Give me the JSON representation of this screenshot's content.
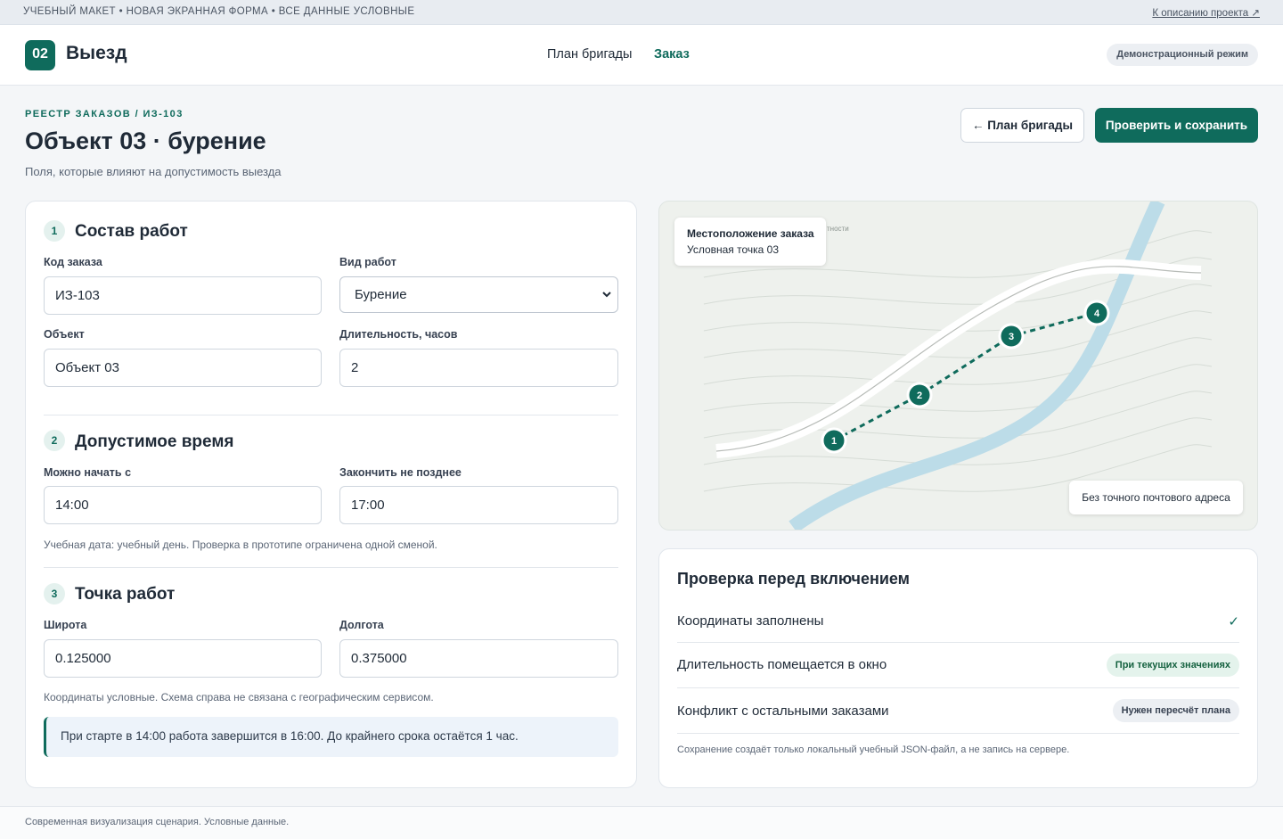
{
  "topbar": {
    "left_text": "УЧЕБНЫЙ МАКЕТ • НОВАЯ ЭКРАННАЯ ФОРМА • ВСЕ ДАННЫЕ УСЛОВНЫЕ",
    "right_link": "К описанию проекта ↗"
  },
  "header": {
    "logo": "02",
    "title": "Выезд",
    "nav": [
      "План бригады",
      "Заказ"
    ],
    "active_nav": "Заказ",
    "badge": "Демонстрационный режим"
  },
  "page": {
    "breadcrumb": "РЕЕСТР ЗАКАЗОВ / ИЗ-103",
    "title": "Объект 03 · бурение",
    "subtitle": "Поля, которые влияют на допустимость выезда",
    "back_button": "← План бригады",
    "save_button": "Проверить и сохранить"
  },
  "form": {
    "section1": {
      "num": "1",
      "title": "Состав работ",
      "order_code_label": "Код заказа",
      "order_code_value": "ИЗ-103",
      "work_type_label": "Вид работ",
      "work_type_value": "Бурение",
      "object_label": "Объект",
      "object_value": "Объект 03",
      "duration_label": "Длительность, часов",
      "duration_value": "2"
    },
    "section2": {
      "num": "2",
      "title": "Допустимое время",
      "start_label": "Можно начать с",
      "start_value": "14:00",
      "end_label": "Закончить не позднее",
      "end_value": "17:00",
      "hint": "Учебная дата: учебный день. Проверка в прототипе ограничена одной сменой."
    },
    "section3": {
      "num": "3",
      "title": "Точка работ",
      "lat_label": "Широта",
      "lat_value": "0.125000",
      "lon_label": "Долгота",
      "lon_value": "0.375000",
      "hint": "Координаты условные. Схема справа не связана с географическим сервисом.",
      "info": "При старте в 14:00 работа завершится в 16:00. До крайнего срока остаётся 1 час."
    }
  },
  "map": {
    "tooltip_title": "Местоположение заказа",
    "tooltip_sub": "Условная точка 03",
    "faint_label": "тности",
    "note": "Без точного почтового адреса",
    "markers": [
      "1",
      "2",
      "3",
      "4"
    ]
  },
  "check": {
    "title": "Проверка перед включением",
    "rows": [
      {
        "label": "Координаты заполнены",
        "status": "✓"
      },
      {
        "label": "Длительность помещается в окно",
        "status": "При текущих значениях"
      },
      {
        "label": "Конфликт с остальными заказами",
        "status": "Нужен пересчёт плана"
      }
    ],
    "footnote": "Сохранение создаёт только локальный учебный JSON-файл, а не запись на сервере."
  },
  "footer": {
    "text": "Современная визуализация сценария. Условные данные."
  },
  "colors": {
    "accent": "#0f6b5c",
    "water": "#bcdce8",
    "road": "#ffffff"
  }
}
